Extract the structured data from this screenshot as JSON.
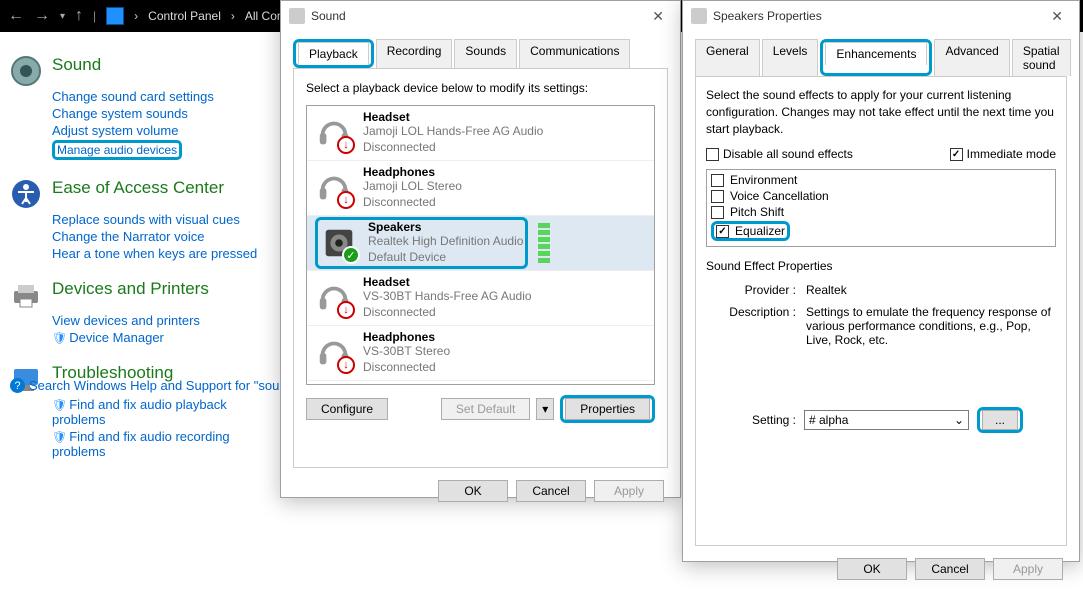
{
  "nav": {
    "path1": "Control Panel",
    "path2": "All Cont..."
  },
  "sidebar": {
    "sound": {
      "title": "Sound",
      "links": [
        "Change sound card settings",
        "Change system sounds",
        "Adjust system volume",
        "Manage audio devices"
      ]
    },
    "ease": {
      "title": "Ease of Access Center",
      "links": [
        "Replace sounds with visual cues",
        "Change the Narrator voice",
        "Hear a tone when keys are pressed"
      ]
    },
    "devices": {
      "title": "Devices and Printers",
      "links": [
        "View devices and printers",
        "Device Manager"
      ]
    },
    "trouble": {
      "title": "Troubleshooting",
      "links": [
        "Find and fix audio playback problems",
        "Find and fix audio recording problems"
      ]
    },
    "search": "Search Windows Help and Support for \"sound\""
  },
  "sound_dlg": {
    "title": "Sound",
    "tabs": [
      "Playback",
      "Recording",
      "Sounds",
      "Communications"
    ],
    "desc": "Select a playback device below to modify its settings:",
    "devices": [
      {
        "name": "Headset",
        "sub1": "Jamoji LOL Hands-Free AG Audio",
        "sub2": "Disconnected",
        "status": "down"
      },
      {
        "name": "Headphones",
        "sub1": "Jamoji LOL Stereo",
        "sub2": "Disconnected",
        "status": "down"
      },
      {
        "name": "Speakers",
        "sub1": "Realtek High Definition Audio",
        "sub2": "Default Device",
        "status": "ok"
      },
      {
        "name": "Headset",
        "sub1": "VS-30BT Hands-Free AG Audio",
        "sub2": "Disconnected",
        "status": "down"
      },
      {
        "name": "Headphones",
        "sub1": "VS-30BT Stereo",
        "sub2": "Disconnected",
        "status": "down"
      }
    ],
    "configure": "Configure",
    "set_default": "Set Default",
    "properties": "Properties",
    "ok": "OK",
    "cancel": "Cancel",
    "apply": "Apply"
  },
  "props_dlg": {
    "title": "Speakers Properties",
    "tabs": [
      "General",
      "Levels",
      "Enhancements",
      "Advanced",
      "Spatial sound"
    ],
    "desc": "Select the sound effects to apply for your current listening configuration. Changes may not take effect until the next time you start playback.",
    "disable_all": "Disable all sound effects",
    "immediate": "Immediate mode",
    "effects": [
      "Environment",
      "Voice Cancellation",
      "Pitch Shift",
      "Equalizer"
    ],
    "section": "Sound Effect Properties",
    "provider_label": "Provider :",
    "provider": "Realtek",
    "desc_label": "Description :",
    "desc_val": "Settings to emulate the frequency response of various performance conditions,  e.g., Pop, Live, Rock, etc.",
    "setting_label": "Setting :",
    "setting_val": "# alpha",
    "browse": "...",
    "ok": "OK",
    "cancel": "Cancel",
    "apply": "Apply"
  }
}
